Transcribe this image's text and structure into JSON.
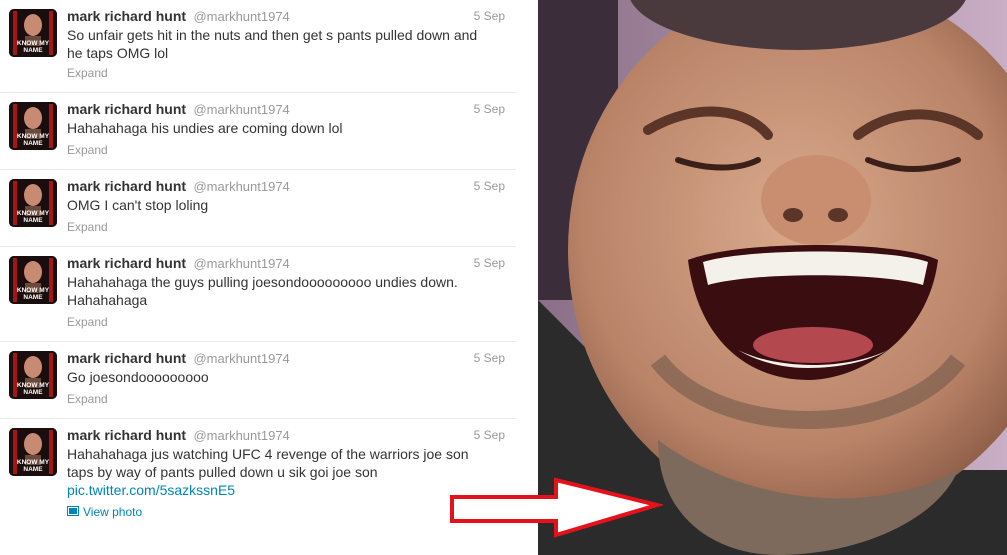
{
  "tweets": [
    {
      "name": "mark richard hunt",
      "handle": "@markhunt1974",
      "time": "5 Sep",
      "text": "So unfair gets hit in the nuts and then get s pants pulled down and he taps OMG lol",
      "action": "Expand"
    },
    {
      "name": "mark richard hunt",
      "handle": "@markhunt1974",
      "time": "5 Sep",
      "text": "Hahahahaga his undies are coming down lol",
      "action": "Expand"
    },
    {
      "name": "mark richard hunt",
      "handle": "@markhunt1974",
      "time": "5 Sep",
      "text": "OMG I can't stop loling",
      "action": "Expand"
    },
    {
      "name": "mark richard hunt",
      "handle": "@markhunt1974",
      "time": "5 Sep",
      "text": "Hahahahaga the guys pulling joesondooooooooo undies down. Hahahahaga",
      "action": "Expand"
    },
    {
      "name": "mark richard hunt",
      "handle": "@markhunt1974",
      "time": "5 Sep",
      "text": "Go joesondooooooooo",
      "action": "Expand"
    },
    {
      "name": "mark richard hunt",
      "handle": "@markhunt1974",
      "time": "5 Sep",
      "text": "Hahahahaga jus watching UFC 4 revenge of the warriors joe son taps by way of pants pulled down u sik goi joe son",
      "link": "pic.twitter.com/5sazkssnE5",
      "action": "View photo"
    }
  ],
  "avatar_logo_text": "KNOW MY NAME",
  "colors": {
    "name": "#333333",
    "meta": "#999999",
    "link": "#0084b4",
    "arrow": "#e5121b",
    "divider": "#e8e8e8"
  },
  "icons": [
    "photo-icon",
    "arrow-pointer-icon"
  ]
}
